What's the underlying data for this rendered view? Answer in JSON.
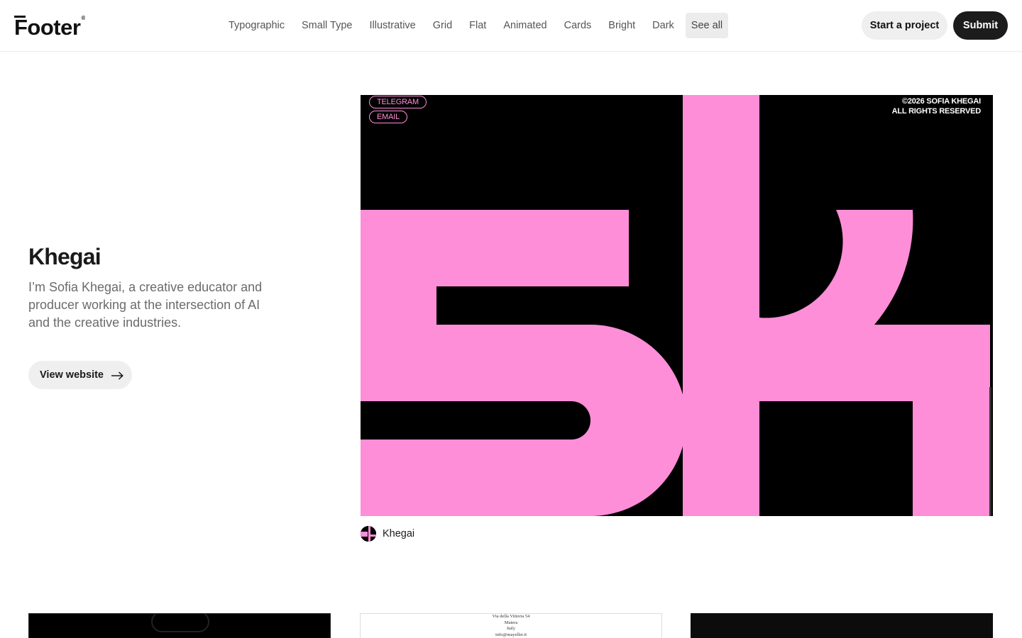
{
  "header": {
    "logo_text": "Footer",
    "logo_mark": "®",
    "nav": [
      {
        "label": "Typographic"
      },
      {
        "label": "Small Type"
      },
      {
        "label": "Illustrative"
      },
      {
        "label": "Grid"
      },
      {
        "label": "Flat"
      },
      {
        "label": "Animated"
      },
      {
        "label": "Cards"
      },
      {
        "label": "Bright"
      },
      {
        "label": "Dark"
      },
      {
        "label": "See all",
        "active": true
      }
    ],
    "start_project_label": "Start a project",
    "submit_label": "Submit"
  },
  "feature": {
    "title": "Khegai",
    "description": "I’m Sofia Khegai, a creative educator and producer working at the intersection of AI and the creative industries.",
    "view_website_label": "View website",
    "arrow_icon": "arrow-right-icon",
    "preview": {
      "pill_1": "TELEGRAM",
      "pill_2": "EMAIL",
      "copyright_line_1": "©2026 SOFIA KHEGAI",
      "copyright_line_2": "ALL RIGHTS RESERVED",
      "art_text": "sk",
      "pink": "#ff8ed8",
      "background": "#000000"
    },
    "author": {
      "name": "Khegai"
    }
  },
  "gallery": {
    "thumb_2_address": [
      "Via della Vittoria 54",
      "Matera",
      "Italy",
      "info@mayeller.it"
    ]
  }
}
